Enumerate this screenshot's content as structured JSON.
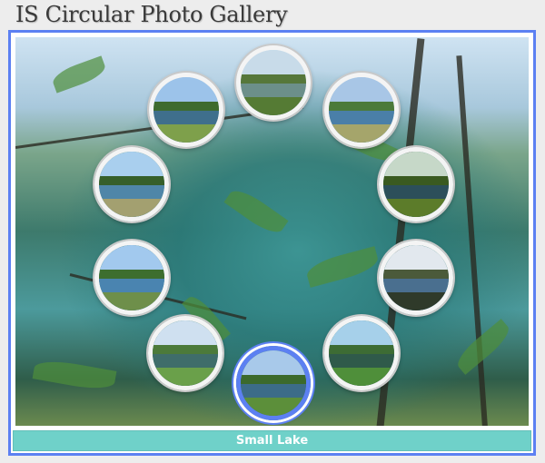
{
  "header": {
    "title": "IS Circular Photo Gallery"
  },
  "caption": {
    "text": "Small Lake"
  },
  "colors": {
    "frame": "#5c80f2",
    "caption_bar": "#6fd1c9",
    "thumb_ring": "#f4f4f4",
    "active_ring": "#5c80f2"
  },
  "gallery": {
    "selected_index": 7,
    "thumbnails": [
      {
        "id": "thumb-1",
        "sky": "#9cc3ea",
        "trees": "#3e6b2e",
        "water": "#3f6f8c",
        "grass": "#7ea04b"
      },
      {
        "id": "thumb-2",
        "sky": "#c8dbe9",
        "trees": "#56773a",
        "water": "#6c8f8a",
        "grass": "#557b34"
      },
      {
        "id": "thumb-3",
        "sky": "#a8c6e6",
        "trees": "#4b7a3a",
        "water": "#4a7fa8",
        "grass": "#a5a56b"
      },
      {
        "id": "thumb-4",
        "sky": "#c6d8c8",
        "trees": "#3a5a20",
        "water": "#2c4f5a",
        "grass": "#5c7c2a"
      },
      {
        "id": "thumb-5",
        "sky": "#e2e8ee",
        "trees": "#4b5a3a",
        "water": "#4a6f8f",
        "grass": "#2f3a2a"
      },
      {
        "id": "thumb-6",
        "sky": "#a6d0ea",
        "trees": "#3d6c34",
        "water": "#2f5a4a",
        "grass": "#4f8f3a"
      },
      {
        "id": "thumb-7",
        "sky": "#a8c9ea",
        "trees": "#3c6a2c",
        "water": "#3c6c88",
        "grass": "#5c8f3a"
      },
      {
        "id": "thumb-8",
        "sky": "#cfe0f0",
        "trees": "#4c7a3a",
        "water": "#3f6d6a",
        "grass": "#6aa04a"
      },
      {
        "id": "thumb-9",
        "sky": "#a2c9ee",
        "trees": "#3d6e2e",
        "water": "#4a84b0",
        "grass": "#6e8f4a"
      },
      {
        "id": "thumb-10",
        "sky": "#a9cfee",
        "trees": "#365f2a",
        "water": "#4f86a8",
        "grass": "#a3a070"
      },
      {
        "id": "thumb-11",
        "sky": "#a8cbe6",
        "trees": "#3e6b34",
        "water": "#3d6f84",
        "grass": "#4d7f36"
      }
    ]
  }
}
